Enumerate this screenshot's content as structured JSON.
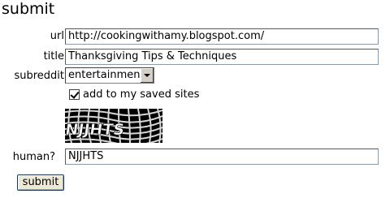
{
  "title": "submit",
  "form": {
    "url_label": "url",
    "url_value": "http://cookingwithamy.blogspot.com/",
    "title_label": "title",
    "title_value": "Thanksgiving Tips & Techniques",
    "subreddit_label": "subreddit",
    "subreddit_value": "entertainment",
    "save_checked": true,
    "save_label": "add to my saved sites",
    "captcha_text": "NJJHTS",
    "human_label": "human?",
    "human_value": "NJJHTS",
    "submit_label": "submit"
  }
}
